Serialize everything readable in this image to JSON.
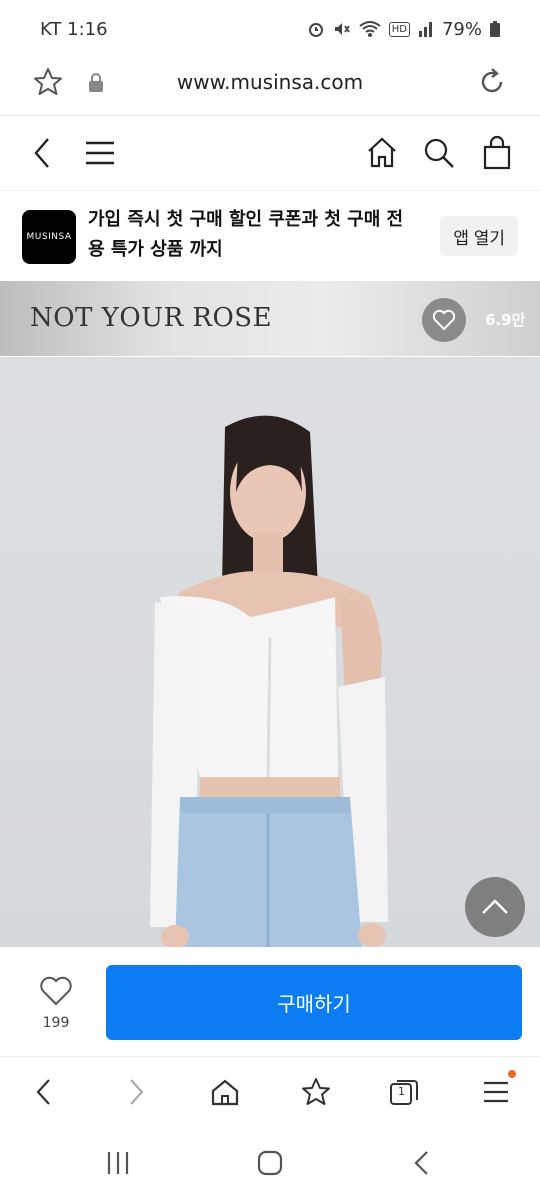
{
  "status_bar": {
    "carrier_time": "KT 1:16",
    "battery": "79%",
    "hd_badge": "HD"
  },
  "browser": {
    "url": "www.musinsa.com"
  },
  "banner": {
    "logo_text": "MUSINSA",
    "message": "가입 즉시 첫 구매 할인 쿠폰과 첫 구매 전용 특가 상품 까지",
    "open_app_label": "앱 열기"
  },
  "brand": {
    "name": "NOT YOUR ROSE",
    "like_count": "6.9만"
  },
  "product": {
    "like_count": "199",
    "buy_label": "구매하기"
  },
  "browser_toolbar": {
    "tab_count": "1"
  },
  "colors": {
    "buy_button": "#0b7cf2",
    "notification_dot": "#e8692b"
  },
  "icons": [
    "star-icon",
    "lock-icon",
    "reload-icon",
    "back-icon",
    "menu-icon",
    "home-icon",
    "search-icon",
    "bag-icon",
    "heart-icon",
    "chevron-up-icon",
    "forward-icon",
    "tabs-icon",
    "hamburger-icon",
    "recents-icon",
    "home-circle-icon"
  ]
}
